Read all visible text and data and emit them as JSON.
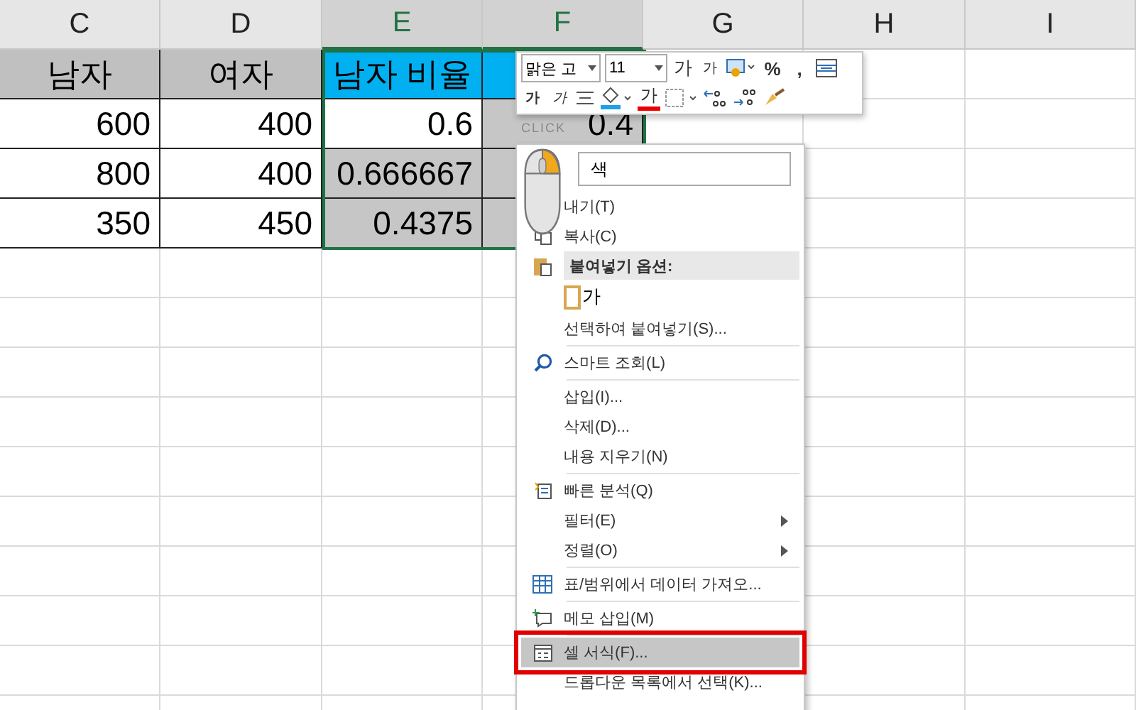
{
  "columns": [
    {
      "label": "C",
      "selected": false
    },
    {
      "label": "D",
      "selected": false
    },
    {
      "label": "E",
      "selected": true
    },
    {
      "label": "F",
      "selected": true
    },
    {
      "label": "G",
      "selected": false
    },
    {
      "label": "H",
      "selected": false
    },
    {
      "label": "I",
      "selected": false
    }
  ],
  "rows": [
    {
      "cells": [
        {
          "text": "남자",
          "kind": "header"
        },
        {
          "text": "여자",
          "kind": "header"
        },
        {
          "text": "남자 비율",
          "kind": "ratio_header"
        },
        {
          "kind": "ratio_header"
        }
      ]
    },
    {
      "cells": [
        {
          "text": "600",
          "kind": "value",
          "selected": false
        },
        {
          "text": "400",
          "kind": "value",
          "selected": false
        },
        {
          "text": "0.6",
          "kind": "value",
          "selected": false
        },
        {
          "text": "0.4",
          "kind": "value",
          "selected": true
        }
      ]
    },
    {
      "cells": [
        {
          "text": "800",
          "kind": "value",
          "selected": false
        },
        {
          "text": "400",
          "kind": "value",
          "selected": false
        },
        {
          "text": "0.666667",
          "kind": "value",
          "selected": true
        },
        {
          "kind": "value",
          "selected": true
        }
      ]
    },
    {
      "cells": [
        {
          "text": "350",
          "kind": "value",
          "selected": false
        },
        {
          "text": "450",
          "kind": "value",
          "selected": false
        },
        {
          "text": "0.4375",
          "kind": "value",
          "selected": true
        },
        {
          "kind": "value",
          "selected": true
        }
      ]
    }
  ],
  "mini_toolbar": {
    "font": "맑은 고",
    "size": "11",
    "row_1": [
      {
        "kind": "grow",
        "text": "가"
      },
      {
        "kind": "shrink",
        "text": "가"
      },
      {
        "kind": "format"
      },
      {
        "kind": "char",
        "text": "%"
      },
      {
        "kind": "char",
        "text": ","
      },
      {
        "kind": "merge"
      }
    ],
    "row_2": [
      {
        "kind": "bold",
        "text": "가"
      },
      {
        "kind": "italic",
        "text": "가"
      },
      {
        "kind": "align"
      },
      {
        "kind": "fill"
      },
      {
        "kind": "fontcolor",
        "text": "가"
      },
      {
        "kind": "border"
      },
      {
        "kind": "decimal_up"
      },
      {
        "kind": "decimal_down"
      },
      {
        "kind": "brush"
      }
    ]
  },
  "context_menu": [
    {
      "kind": "search",
      "text": "색"
    },
    {
      "kind": "cut",
      "label": "내기(T)",
      "selected": false
    },
    {
      "kind": "copy",
      "label": "복사(C)",
      "selected": false
    },
    {
      "kind": "header",
      "label": "붙여넣기 옵션:"
    },
    {
      "kind": "paste",
      "text": "가"
    },
    {
      "kind": "item",
      "label": "선택하여 붙여넣기(S)...",
      "selected": false
    },
    {
      "kind": "separator"
    },
    {
      "kind": "lookup",
      "label": "스마트 조회(L)",
      "selected": false
    },
    {
      "kind": "separator"
    },
    {
      "kind": "item",
      "label": "삽입(I)...",
      "selected": false
    },
    {
      "kind": "item",
      "label": "삭제(D)...",
      "selected": false
    },
    {
      "kind": "item",
      "label": "내용 지우기(N)",
      "selected": false
    },
    {
      "kind": "separator"
    },
    {
      "kind": "analysis",
      "label": "빠른 분석(Q)",
      "selected": false
    },
    {
      "kind": "submenu",
      "label": "필터(E)",
      "selected": false
    },
    {
      "kind": "submenu",
      "label": "정렬(O)",
      "selected": false
    },
    {
      "kind": "separator"
    },
    {
      "kind": "table",
      "label": "표/범위에서 데이터 가져오...",
      "selected": false
    },
    {
      "kind": "separator"
    },
    {
      "kind": "note",
      "label": "메모 삽입(M)",
      "selected": false
    },
    {
      "kind": "separator"
    },
    {
      "kind": "format",
      "label": "셀 서식(F)...",
      "selected": true
    },
    {
      "kind": "item",
      "label": "드롭다운 목록에서 선택(K)...",
      "selected": false
    }
  ],
  "cursor_label": "CLICK"
}
